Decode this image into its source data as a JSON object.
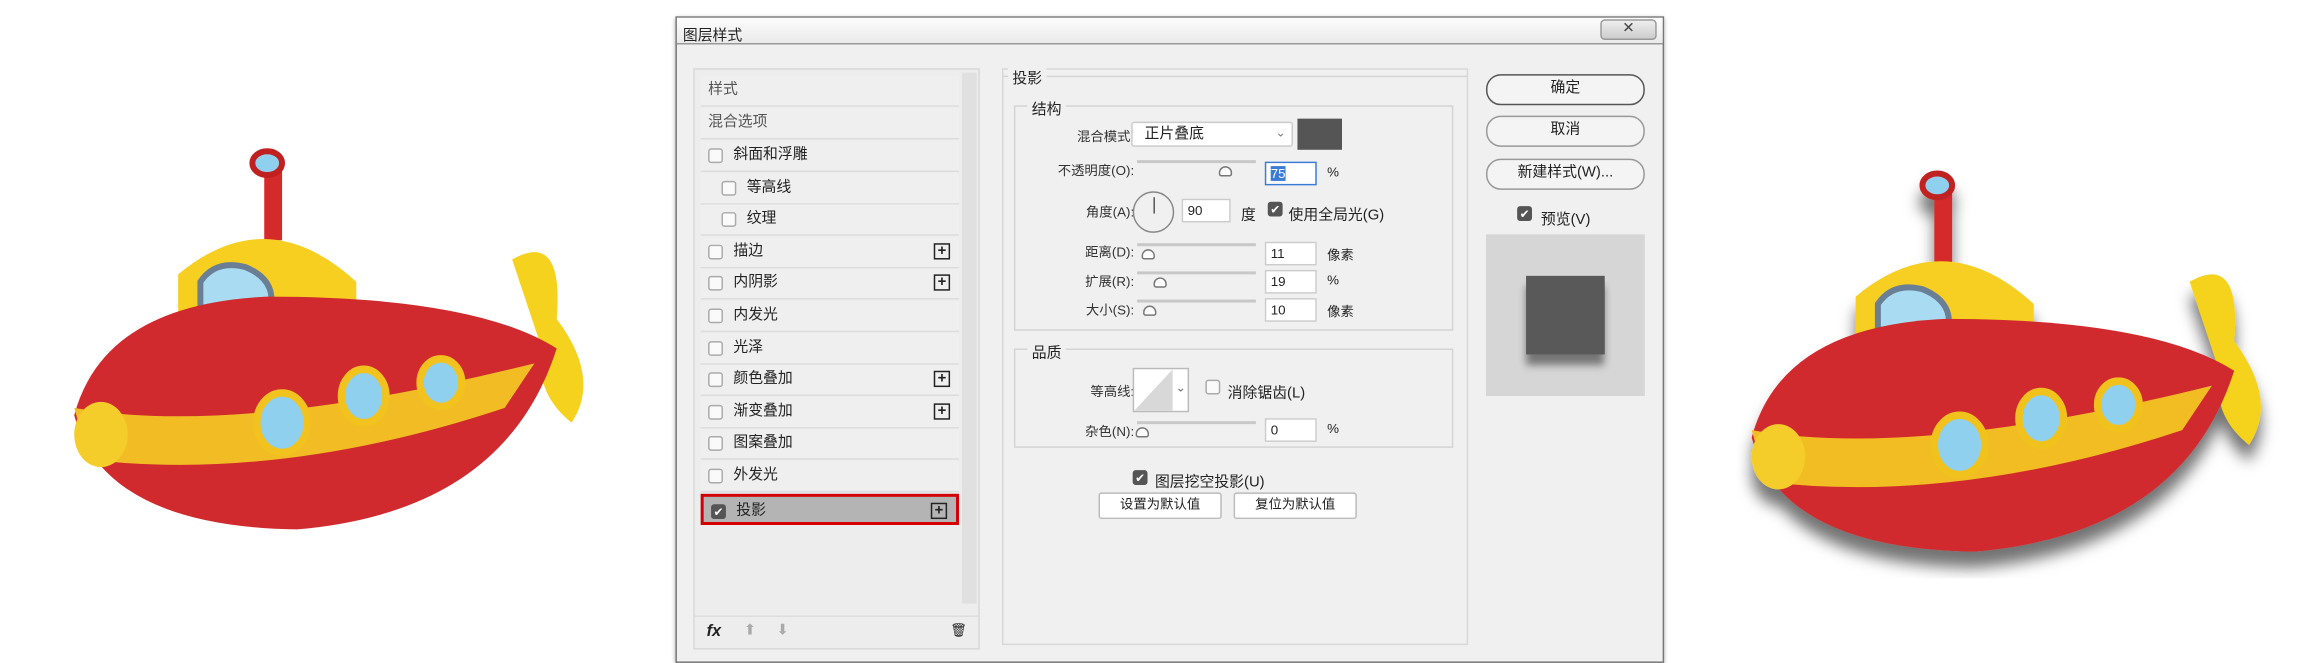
{
  "dialog": {
    "title": "图层样式",
    "close": "✕"
  },
  "styles_list": {
    "header": "样式",
    "blend_options": "混合选项",
    "items": [
      {
        "label": "斜面和浮雕",
        "checked": false,
        "plus": false
      },
      {
        "label": "等高线",
        "checked": false,
        "plus": false,
        "sub": true
      },
      {
        "label": "纹理",
        "checked": false,
        "plus": false,
        "sub": true
      },
      {
        "label": "描边",
        "checked": false,
        "plus": true
      },
      {
        "label": "内阴影",
        "checked": false,
        "plus": true
      },
      {
        "label": "内发光",
        "checked": false,
        "plus": false
      },
      {
        "label": "光泽",
        "checked": false,
        "plus": false
      },
      {
        "label": "颜色叠加",
        "checked": false,
        "plus": true
      },
      {
        "label": "渐变叠加",
        "checked": false,
        "plus": true
      },
      {
        "label": "图案叠加",
        "checked": false,
        "plus": false
      },
      {
        "label": "外发光",
        "checked": false,
        "plus": false
      },
      {
        "label": "投影",
        "checked": true,
        "plus": true,
        "selected": true
      }
    ],
    "toolbar": {
      "fx": "fx",
      "up": "⬆",
      "down": "⬇",
      "trash": "🗑"
    }
  },
  "drop_shadow": {
    "title": "投影",
    "structure": {
      "title": "结构",
      "blend_mode_label": "混合模式:",
      "blend_mode_value": "正片叠底",
      "shadow_color": "#555555",
      "opacity_label": "不透明度(O):",
      "opacity": "75",
      "opacity_unit": "%",
      "angle_label": "角度(A):",
      "angle": "90",
      "angle_unit": "度",
      "global_light_label": "使用全局光(G)",
      "global_light": true,
      "distance_label": "距离(D):",
      "distance": "11",
      "distance_unit": "像素",
      "spread_label": "扩展(R):",
      "spread": "19",
      "spread_unit": "%",
      "size_label": "大小(S):",
      "size": "10",
      "size_unit": "像素"
    },
    "quality": {
      "title": "品质",
      "contour_label": "等高线:",
      "anti_alias_label": "消除锯齿(L)",
      "anti_alias": false,
      "noise_label": "杂色(N):",
      "noise": "0",
      "noise_unit": "%"
    },
    "knockout_label": "图层挖空投影(U)",
    "knockout": true,
    "make_default": "设置为默认值",
    "reset_default": "复位为默认值"
  },
  "actions": {
    "ok": "确定",
    "cancel": "取消",
    "new_style": "新建样式(W)...",
    "preview_label": "预览(V)",
    "preview": true
  }
}
